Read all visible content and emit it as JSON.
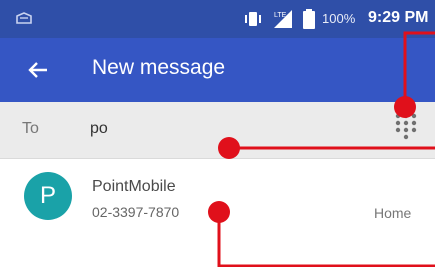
{
  "status_bar": {
    "battery_text": "100%",
    "time": "9:29 PM",
    "icons": [
      "notification-icon",
      "vibrate-icon",
      "signal-icon",
      "battery-icon"
    ]
  },
  "app_bar": {
    "title": "New message",
    "back_icon": "back-arrow-icon"
  },
  "recipient": {
    "label": "To",
    "value": "po",
    "dialpad_icon": "dialpad-icon"
  },
  "suggestion": {
    "avatar_letter": "P",
    "name": "PointMobile",
    "number": "02-3397-7870",
    "type": "Home"
  },
  "colors": {
    "status_bar": "#2f4fa8",
    "app_bar": "#3556c4",
    "recipient_bg": "#ebebeb",
    "avatar": "#1aa2a8",
    "annotation": "#e0101b"
  }
}
